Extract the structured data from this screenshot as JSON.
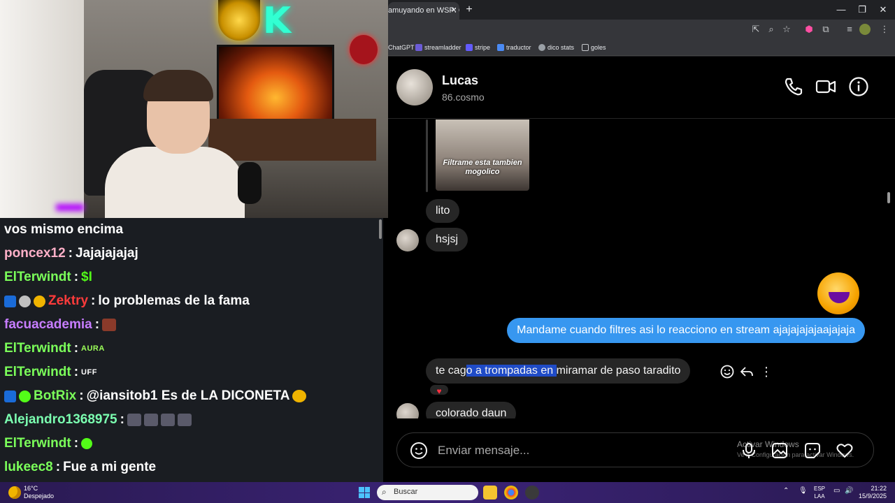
{
  "chat": {
    "messages": [
      {
        "user": "",
        "sep": "",
        "text": "vos mismo encima",
        "user_color": "#ffffff"
      },
      {
        "user": "poncex12",
        "sep": " :",
        "text": "Jajajajajaj",
        "user_color": "#ffb0c8"
      },
      {
        "user": "ElTerwindt",
        "sep": " :",
        "text": "$I",
        "user_color": "#7bff5a",
        "text_color": "#53fc18"
      },
      {
        "user": "Zektry",
        "sep": " :",
        "text": "lo problemas de la fama",
        "user_color": "#ff3b3b"
      },
      {
        "user": "facuacademia",
        "sep": " :",
        "text": "",
        "user_color": "#c77dff"
      },
      {
        "user": "ElTerwindt",
        "sep": " :",
        "text": "AURA",
        "user_color": "#7bff5a"
      },
      {
        "user": "ElTerwindt",
        "sep": " :",
        "text": "UFF",
        "user_color": "#7bff5a"
      },
      {
        "user": "BotRix",
        "sep": " :",
        "text": "@iansitob1 Es de LA DICONETA",
        "user_color": "#7bff5a"
      },
      {
        "user": "Alejandro1368975",
        "sep": " :",
        "text": "",
        "user_color": "#7bffb0"
      },
      {
        "user": "ElTerwindt",
        "sep": " :",
        "text": "",
        "user_color": "#7bff5a"
      },
      {
        "user": "lukeec8",
        "sep": " :",
        "text": "Fue a mi gente",
        "user_color": "#7bff5a"
      }
    ]
  },
  "browser": {
    "tab_title": "amuyando en WSP: Co",
    "bookmarks": [
      "ChatGPT",
      "streamladder",
      "stripe",
      "traductor",
      "dico stats",
      "goles"
    ]
  },
  "dm": {
    "contact_name": "Lucas",
    "contact_username": "86.cosmo",
    "story_caption": "Filtrame esta tambien mogolico",
    "msg_lito": "lito",
    "msg_hsjsj": "hsjsj",
    "msg_out": "Mandame cuando filtres asi lo reacciono en stream ajajajajajaajajaja",
    "msg_reply_pre": "te cag",
    "msg_reply_sel": "o a trompadas en ",
    "msg_reply_post": "miramar de paso taradito",
    "msg_last": "colorado daun",
    "reaction": "♥",
    "composer_placeholder": "Enviar mensaje...",
    "windows_watermark": "Activar Windows",
    "windows_watermark_sub": "Ve a Configuración para activar Windows."
  },
  "taskbar": {
    "temp": "16°C",
    "condition": "Despejado",
    "search_label": "Buscar",
    "lang_top": "ESP",
    "lang_bottom": "LAA",
    "time": "21:22",
    "date": "15/9/2025"
  },
  "colors": {
    "ig_blue": "#3797f0",
    "kick_green": "#53fc18",
    "chat_bg": "#1a1d22",
    "selection": "#1f4bc7"
  }
}
